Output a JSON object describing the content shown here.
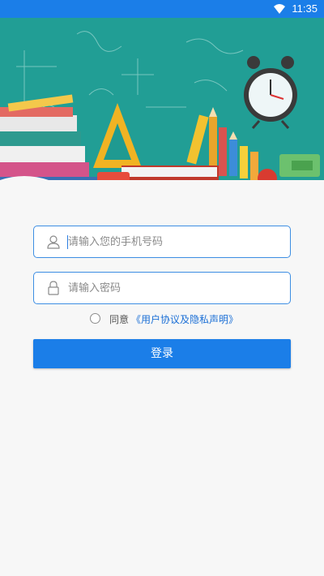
{
  "status_bar": {
    "time": "11:35",
    "wifi_icon": "wifi-icon"
  },
  "banner": {
    "illustration": "classroom-chalkboard-books-clock-pencils"
  },
  "form": {
    "phone_placeholder": "请输入您的手机号码",
    "phone_icon": "user-icon",
    "password_placeholder": "请输入密码",
    "password_icon": "lock-icon",
    "agree_prefix": "同意",
    "agree_link": "《用户协议及隐私声明》",
    "agree_checked": false,
    "login_label": "登录"
  },
  "colors": {
    "accent": "#1b7ee8",
    "input_border": "#3d8ee3",
    "link": "#1b6fd6",
    "background": "#f7f7f7"
  }
}
